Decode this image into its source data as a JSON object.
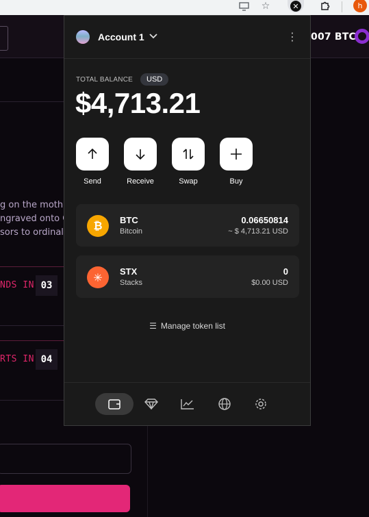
{
  "browser": {
    "icons": [
      "monitor-icon",
      "star-icon",
      "wallet-extension-icon",
      "puzzle-icon",
      "profile-avatar"
    ],
    "profile_initial": "h"
  },
  "background": {
    "btc_balance_fragment": "007 BTC",
    "body_lines": [
      "g on the moth",
      "ngraved onto C",
      "sors to ordinals"
    ],
    "timer1_label": "NDS IN",
    "timer1_value": "03",
    "timer2_label": "RTS IN",
    "timer2_value": "04",
    "accent_color": "#e32777"
  },
  "wallet": {
    "account_name": "Account 1",
    "total_balance_label": "TOTAL BALANCE",
    "currency_badge": "USD",
    "total_balance": "$4,713.21",
    "actions": [
      {
        "label": "Send",
        "icon": "arrow-up-icon"
      },
      {
        "label": "Receive",
        "icon": "arrow-down-icon"
      },
      {
        "label": "Swap",
        "icon": "swap-icon"
      },
      {
        "label": "Buy",
        "icon": "plus-icon"
      }
    ],
    "tokens": [
      {
        "symbol": "BTC",
        "name": "Bitcoin",
        "amount": "0.06650814",
        "usd": "~ $ 4,713.21 USD",
        "color": "#f7a600",
        "glyph": "₿"
      },
      {
        "symbol": "STX",
        "name": "Stacks",
        "amount": "0",
        "usd": "$0.00 USD",
        "color": "#fc6432",
        "glyph": "✳"
      }
    ],
    "manage_tokens": "Manage token list",
    "nav": [
      "wallet-icon",
      "gem-icon",
      "chart-icon",
      "globe-icon",
      "settings-icon"
    ],
    "active_nav": "wallet-icon"
  }
}
